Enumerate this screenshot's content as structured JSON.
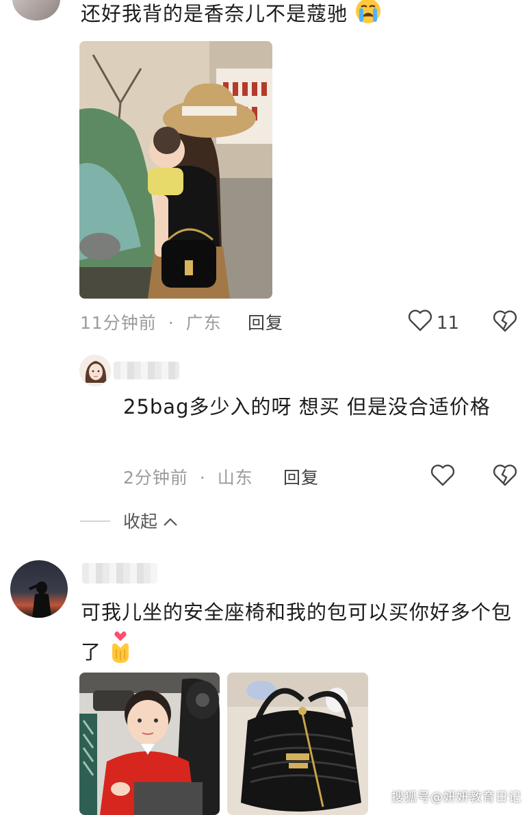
{
  "comment1": {
    "text": "还好我背的是香奈儿不是蔻驰",
    "emoji_icon": "crying-face-icon",
    "time": "11分钟前",
    "location": "广东",
    "reply_label": "回复",
    "like_count": "11"
  },
  "reply1": {
    "text": "25bag多少入的呀 想买 但是没合适价格",
    "time": "2分钟前",
    "location": "山东",
    "reply_label": "回复"
  },
  "collapse_label": "收起",
  "comment2": {
    "text": "可我儿坐的安全座椅和我的包可以买你好多个包了",
    "emoji_icon": "heart-hands-icon"
  },
  "watermark": "搜狐号@妍妍教育日记",
  "colors": {
    "meta": "#9b9b9b",
    "text": "#1c1c1c",
    "icon": "#444444"
  }
}
